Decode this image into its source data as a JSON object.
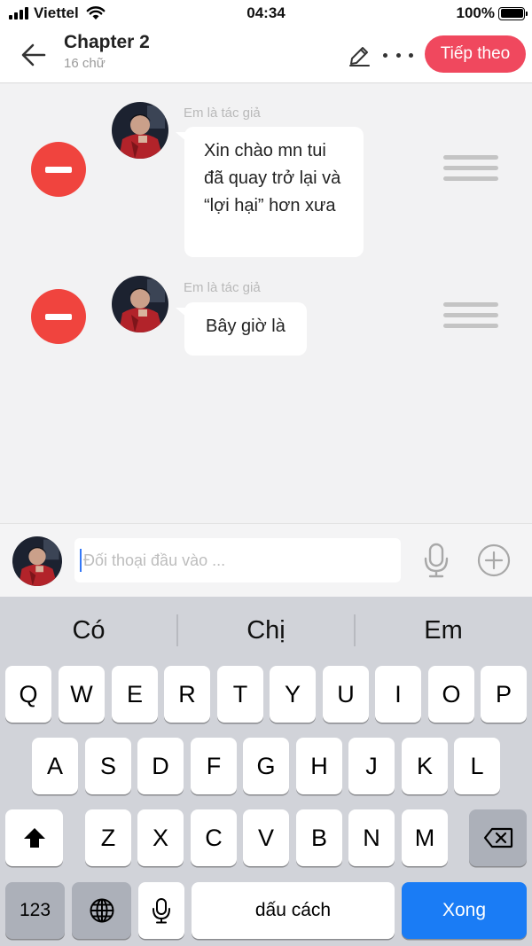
{
  "status_bar": {
    "carrier": "Viettel",
    "time": "04:34",
    "battery": "100%"
  },
  "header": {
    "title": "Chapter 2",
    "subtitle": "16 chữ",
    "next_label": "Tiếp theo"
  },
  "messages": [
    {
      "author": "Em là tác giả",
      "text": "Xin chào mn tui đã quay trở lại và “lợi hại” hơn xưa"
    },
    {
      "author": "Em là tác giả",
      "text": "Bây giờ là"
    }
  ],
  "input": {
    "placeholder": "Đối thoại đầu vào ..."
  },
  "keyboard": {
    "suggestions": [
      "Có",
      "Chị",
      "Em"
    ],
    "row1": [
      "Q",
      "W",
      "E",
      "R",
      "T",
      "Y",
      "U",
      "I",
      "O",
      "P"
    ],
    "row2": [
      "A",
      "S",
      "D",
      "F",
      "G",
      "H",
      "J",
      "K",
      "L"
    ],
    "row3": [
      "Z",
      "X",
      "C",
      "V",
      "B",
      "N",
      "M"
    ],
    "numbers_label": "123",
    "space_label": "dấu cách",
    "done_label": "Xong"
  },
  "colors": {
    "accent": "#f0485e",
    "remove": "#f0443e",
    "done_key": "#1a7cf5"
  },
  "icons": [
    "signal-icon",
    "wifi-icon",
    "battery-icon",
    "back-arrow-icon",
    "pencil-icon",
    "more-icon",
    "minus-icon",
    "drag-handle-icon",
    "microphone-icon",
    "plus-circle-icon",
    "shift-icon",
    "backspace-icon",
    "globe-icon"
  ]
}
